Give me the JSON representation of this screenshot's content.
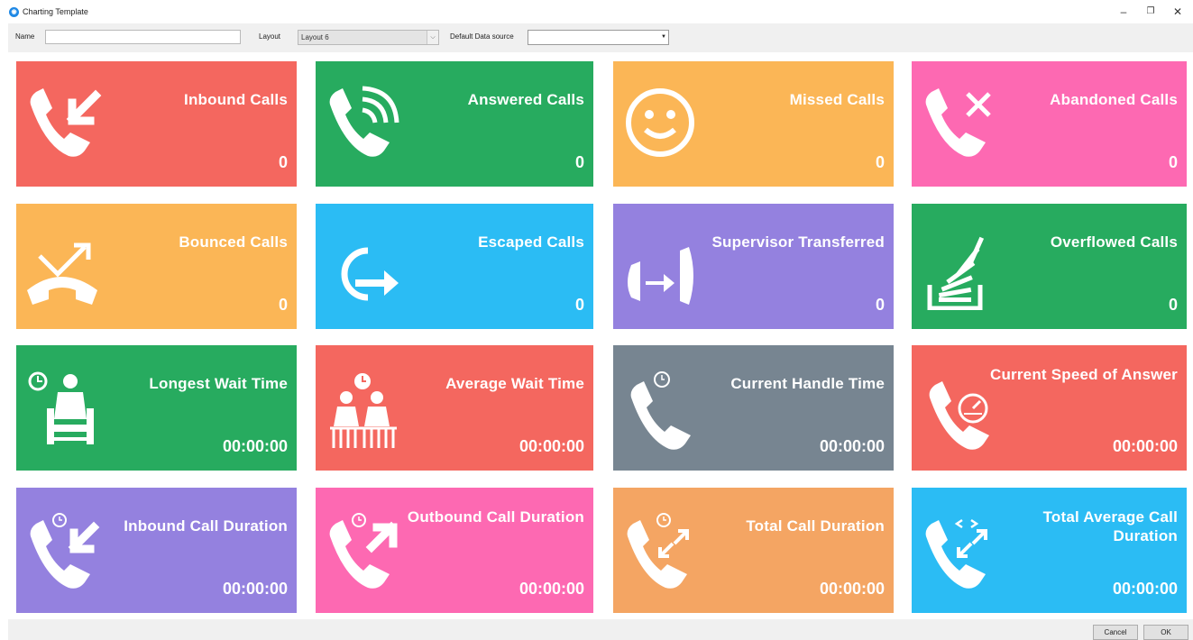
{
  "window": {
    "title": "Charting Template"
  },
  "toolbar": {
    "name_label": "Name",
    "name_value": "",
    "layout_label": "Layout",
    "layout_value": "Layout 6",
    "datasource_label": "Default Data source",
    "datasource_value": ""
  },
  "tiles": [
    {
      "title": "Inbound Calls",
      "value": "0",
      "color": "#f4675f",
      "icon": "inbound-call-icon"
    },
    {
      "title": "Answered Calls",
      "value": "0",
      "color": "#27ab5f",
      "icon": "answered-call-icon"
    },
    {
      "title": "Missed Calls",
      "value": "0",
      "color": "#fbb656",
      "icon": "smiley-icon"
    },
    {
      "title": "Abandoned Calls",
      "value": "0",
      "color": "#fd69b2",
      "icon": "abandoned-call-icon"
    },
    {
      "title": "Bounced Calls",
      "value": "0",
      "color": "#fbb656",
      "icon": "bounced-call-icon"
    },
    {
      "title": "Escaped Calls",
      "value": "0",
      "color": "#2bbcf4",
      "icon": "escape-icon"
    },
    {
      "title": "Supervisor Transferred",
      "value": "0",
      "color": "#9481df",
      "icon": "transfer-call-icon"
    },
    {
      "title": "Overflowed Calls",
      "value": "0",
      "color": "#27ab5f",
      "icon": "overflow-stack-icon"
    },
    {
      "title": "Longest Wait Time",
      "value": "00:00:00",
      "color": "#27ab5f",
      "icon": "waiting-person-icon"
    },
    {
      "title": "Average Wait Time",
      "value": "00:00:00",
      "color": "#f4675f",
      "icon": "waiting-people-icon"
    },
    {
      "title": "Current Handle Time",
      "value": "00:00:00",
      "color": "#778591",
      "icon": "call-timer-icon"
    },
    {
      "title": "Current Speed of Answer",
      "value": "00:00:00",
      "color": "#f4675f",
      "icon": "call-speedometer-icon"
    },
    {
      "title": "Inbound Call Duration",
      "value": "00:00:00",
      "color": "#9481df",
      "icon": "inbound-duration-icon"
    },
    {
      "title": "Outbound Call Duration",
      "value": "00:00:00",
      "color": "#fd69b2",
      "icon": "outbound-duration-icon"
    },
    {
      "title": "Total Call Duration",
      "value": "00:00:00",
      "color": "#f4a563",
      "icon": "total-duration-icon"
    },
    {
      "title": "Total Average Call Duration",
      "value": "00:00:00",
      "color": "#2bbcf4",
      "icon": "average-duration-icon"
    }
  ],
  "buttons": {
    "cancel": "Cancel",
    "ok": "OK"
  }
}
